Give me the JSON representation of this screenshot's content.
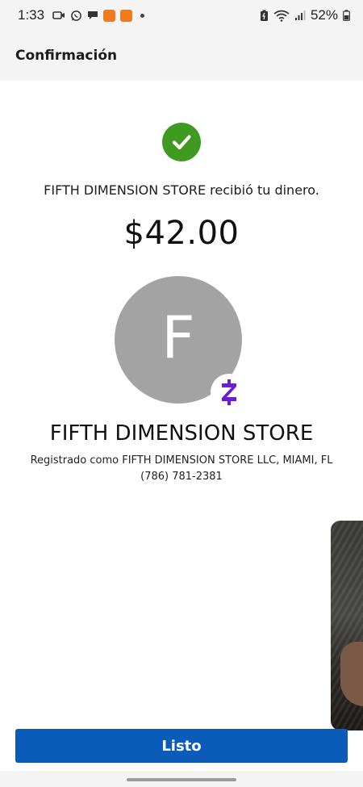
{
  "status_bar": {
    "time": "1:33",
    "battery_percent": "52%",
    "left_icons": [
      "video-icon",
      "whatsapp-icon",
      "chat-bubble-icon",
      "app-notification-icon",
      "app-notification-icon"
    ],
    "right_icons": [
      "battery-saver-icon",
      "wifi-icon",
      "signal-icon",
      "battery-icon"
    ]
  },
  "header": {
    "title": "Confirmación"
  },
  "confirmation": {
    "message": "FIFTH DIMENSION STORE recibió tu dinero.",
    "amount": "$42.00",
    "avatar_letter": "F",
    "store_name": "FIFTH DIMENSION STORE",
    "registered_as": "Registrado como FIFTH DIMENSION STORE LLC, MIAMI, FL",
    "phone": "(786) 781-2381"
  },
  "footer": {
    "done_label": "Listo"
  },
  "colors": {
    "success_green": "#3e9b20",
    "zelle_purple": "#6d1ed4",
    "button_blue": "#0b5cb8",
    "avatar_gray": "#a3a3a3"
  }
}
